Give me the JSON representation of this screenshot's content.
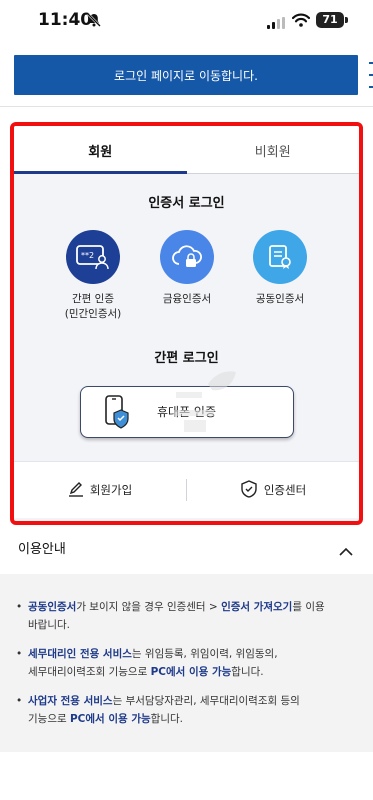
{
  "status": {
    "time": "11:40",
    "battery": "71"
  },
  "banner": {
    "text": "로그인 페이지로 이동합니다."
  },
  "tabs": [
    {
      "label": "회원",
      "active": true
    },
    {
      "label": "비회원",
      "active": false
    }
  ],
  "certificate_login": {
    "title": "인증서 로그인",
    "options": [
      {
        "label_line1": "간편 인증",
        "label_line2": "(민간인증서)",
        "icon": "id-card-icon"
      },
      {
        "label_line1": "금융인증서",
        "label_line2": "",
        "icon": "cloud-lock-icon"
      },
      {
        "label_line1": "공동인증서",
        "label_line2": "",
        "icon": "certificate-icon"
      }
    ]
  },
  "simple_login": {
    "title": "간편 로그인",
    "phone_button": "휴대폰 인증"
  },
  "bottom_links": {
    "signup": "회원가입",
    "cert_center": "인증센터"
  },
  "usage": {
    "title": "이용안내",
    "items": [
      {
        "parts": [
          "공동인증서",
          "가 보이지 않을 경우 인증센터 > ",
          "인증서 가져오기",
          "를 이용",
          "바랍니다."
        ]
      },
      {
        "parts": [
          "세무대리인 전용 서비스",
          "는 위임등록, 위임이력, 위임동의,",
          "세무대리이력조회 기능으로 ",
          "PC에서 이용 가능",
          "합니다."
        ]
      },
      {
        "parts": [
          "사업자 전용 서비스",
          "는 부서담당자관리, 세무대리이력조회 등의",
          "기능으로 ",
          "PC에서 이용 가능",
          "합니다."
        ]
      }
    ]
  },
  "colors": {
    "primary": "#1558a8",
    "navy": "#1e3a8a",
    "highlight_border": "#f20f0f",
    "panel_bg": "#f3f4f8"
  }
}
